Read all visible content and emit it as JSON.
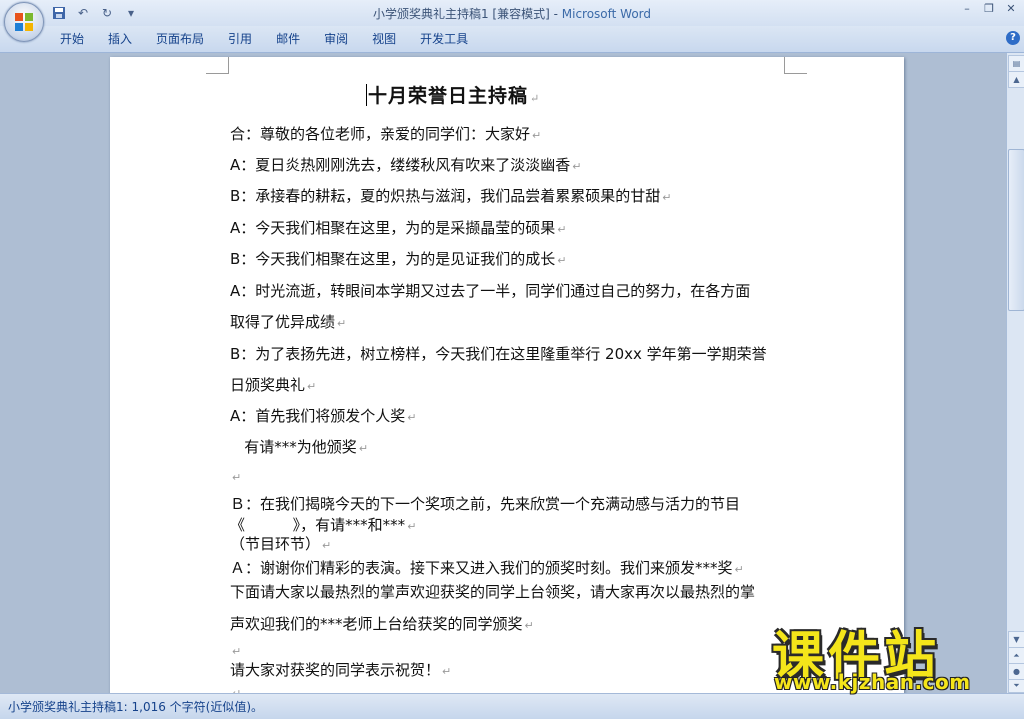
{
  "titlebar": {
    "doc": "小学颁奖典礼主持稿1 [兼容模式] - ",
    "app": "Microsoft Word",
    "qat_icons": [
      "save-icon",
      "undo-icon",
      "redo-icon",
      "customize-icon"
    ]
  },
  "ribbon": {
    "tabs": [
      "开始",
      "插入",
      "页面布局",
      "引用",
      "邮件",
      "审阅",
      "视图",
      "开发工具"
    ],
    "help": "?"
  },
  "document": {
    "title": "十月荣誉日主持稿",
    "paragraph_mark": "↵",
    "lines": [
      "合：尊敬的各位老师，亲爱的同学们：大家好",
      "A：夏日炎热刚刚洗去，缕缕秋风有吹来了淡淡幽香",
      "B：承接春的耕耘，夏的炽热与滋润，我们品尝着累累硕果的甘甜",
      "A：今天我们相聚在这里，为的是采撷晶莹的硕果",
      "B：今天我们相聚在这里，为的是见证我们的成长",
      "A：时光流逝，转眼间本学期又过去了一半，同学们通过自己的努力，在各方面",
      "取得了优异成绩",
      "B：为了表扬先进，树立榜样，今天我们在这里隆重举行 20xx 学年第一学期荣誉",
      "日颁奖典礼",
      "A：首先我们将颁发个人奖",
      "   有请***为他颁奖",
      "",
      "Ｂ：在我们揭晓今天的下一个奖项之前，先来欣赏一个充满动感与活力的节目",
      "《          》，有请***和***",
      "（节目环节）",
      "Ａ：谢谢你们精彩的表演。接下来又进入我们的颁奖时刻。我们来颁发***奖",
      "下面请大家以最热烈的掌声欢迎获奖的同学上台领奖，请大家再次以最热烈的掌",
      "声欢迎我们的***老师上台给获奖的同学颁奖",
      "",
      "请大家对获奖的同学表示祝贺！",
      ""
    ]
  },
  "status": {
    "text": "小学颁奖典礼主持稿1: 1,016 个字符(近似值)。"
  },
  "watermark": {
    "logo": "课件站",
    "url": "www.kjzhan.com"
  }
}
